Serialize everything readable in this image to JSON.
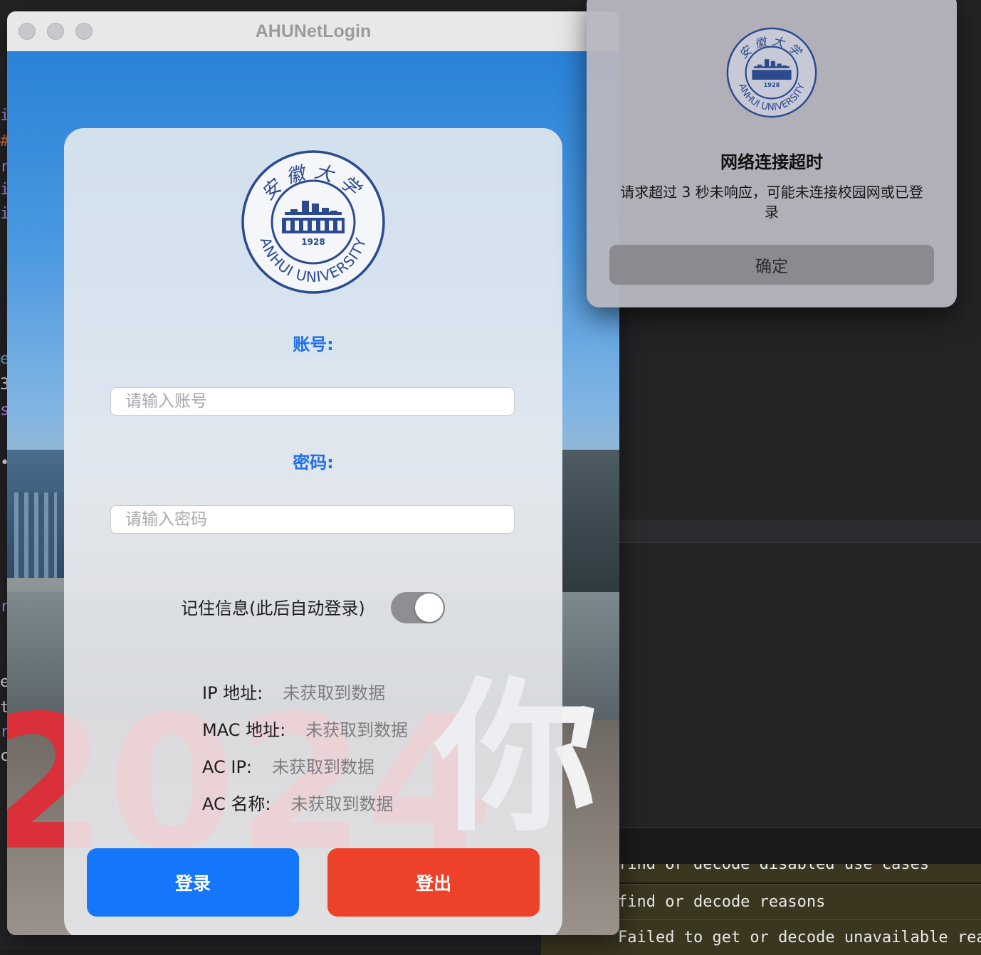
{
  "window": {
    "title": "AHUNetLogin"
  },
  "login": {
    "account_label": "账号:",
    "account_placeholder": "请输入账号",
    "password_label": "密码:",
    "password_placeholder": "请输入密码",
    "remember_label": "记住信息(此后自动登录)",
    "remember_enabled": true,
    "info": [
      {
        "key": "IP 地址:",
        "value": "未获取到数据"
      },
      {
        "key": "MAC 地址:",
        "value": "未获取到数据"
      },
      {
        "key": "AC IP:",
        "value": "未获取到数据"
      },
      {
        "key": "AC 名称:",
        "value": "未获取到数据"
      }
    ],
    "login_button": "登录",
    "logout_button": "登出"
  },
  "logo": {
    "year": "1928",
    "name": "ANHUI UNIVERSITY",
    "calligraphy": "安徽大学"
  },
  "alert": {
    "title": "网络连接超时",
    "message": "请求超过 3 秒未响应，可能未连接校园网或已登录",
    "button": "确定"
  },
  "background": {
    "photo_text_1": "2024",
    "photo_text_2": "你",
    "terminal_lines": [
      "find or decode disabled use cases",
      "find or decode reasons",
      "Failed to get or decode unavailable reaso"
    ],
    "gutter_chars": [
      "i",
      "#",
      "r",
      "i",
      "i",
      "e",
      "3",
      "s",
      "•",
      "r",
      "e",
      "t",
      "r",
      "c"
    ]
  },
  "colors": {
    "accent": "#1476fb",
    "danger": "#ee4129",
    "label_blue": "#1f6fe8"
  }
}
